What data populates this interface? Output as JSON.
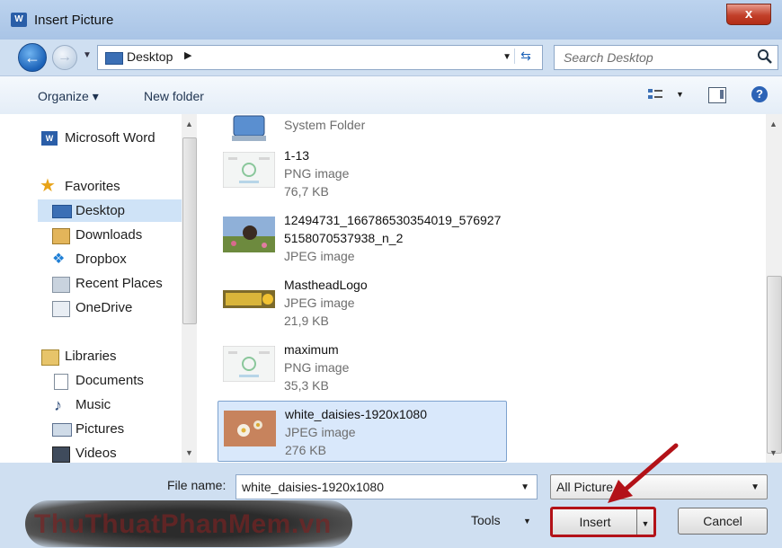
{
  "window": {
    "title": "Insert Picture",
    "app_icon": "W",
    "close_label": "x"
  },
  "addressbar": {
    "location": "Desktop",
    "search_placeholder": "Search Desktop"
  },
  "toolbar": {
    "organize_label": "Organize ▾",
    "new_folder_label": "New folder",
    "help_label": "?"
  },
  "navigation": {
    "items": [
      {
        "label": "Microsoft Word",
        "icon": "word-icon"
      },
      {
        "label": "Favorites",
        "icon": "star-icon"
      },
      {
        "label": "Desktop",
        "icon": "desktop-icon",
        "selected": true
      },
      {
        "label": "Downloads",
        "icon": "downloads-icon"
      },
      {
        "label": "Dropbox",
        "icon": "dropbox-icon"
      },
      {
        "label": "Recent Places",
        "icon": "recent-places-icon"
      },
      {
        "label": "OneDrive",
        "icon": "onedrive-icon"
      },
      {
        "label": "Libraries",
        "icon": "libraries-icon"
      },
      {
        "label": "Documents",
        "icon": "documents-icon"
      },
      {
        "label": "Music",
        "icon": "music-icon"
      },
      {
        "label": "Pictures",
        "icon": "pictures-icon"
      },
      {
        "label": "Videos",
        "icon": "videos-icon"
      }
    ]
  },
  "files": [
    {
      "name": "System Folder",
      "type": "",
      "size": ""
    },
    {
      "name": "1-13",
      "type": "PNG image",
      "size": "76,7 KB"
    },
    {
      "name": "12494731_166786530354019_576927",
      "name2": "5158070537938_n_2",
      "type": "JPEG image",
      "size": ""
    },
    {
      "name": "MastheadLogo",
      "type": "JPEG image",
      "size": "21,9 KB"
    },
    {
      "name": "maximum",
      "type": "PNG image",
      "size": "35,3 KB"
    },
    {
      "name": "white_daisies-1920x1080",
      "type": "JPEG image",
      "size": "276 KB",
      "selected": true
    }
  ],
  "footer": {
    "file_name_label": "File name:",
    "file_name_value": "white_daisies-1920x1080",
    "filter_value": "All Picture",
    "tools_label": "Tools",
    "insert_label": "Insert",
    "cancel_label": "Cancel",
    "watermark_text": "ThuThuatPhanMem.vn"
  },
  "colors": {
    "selection": "#cfe3f7",
    "annotation": "#b31218",
    "accent": "#2c63b6"
  }
}
